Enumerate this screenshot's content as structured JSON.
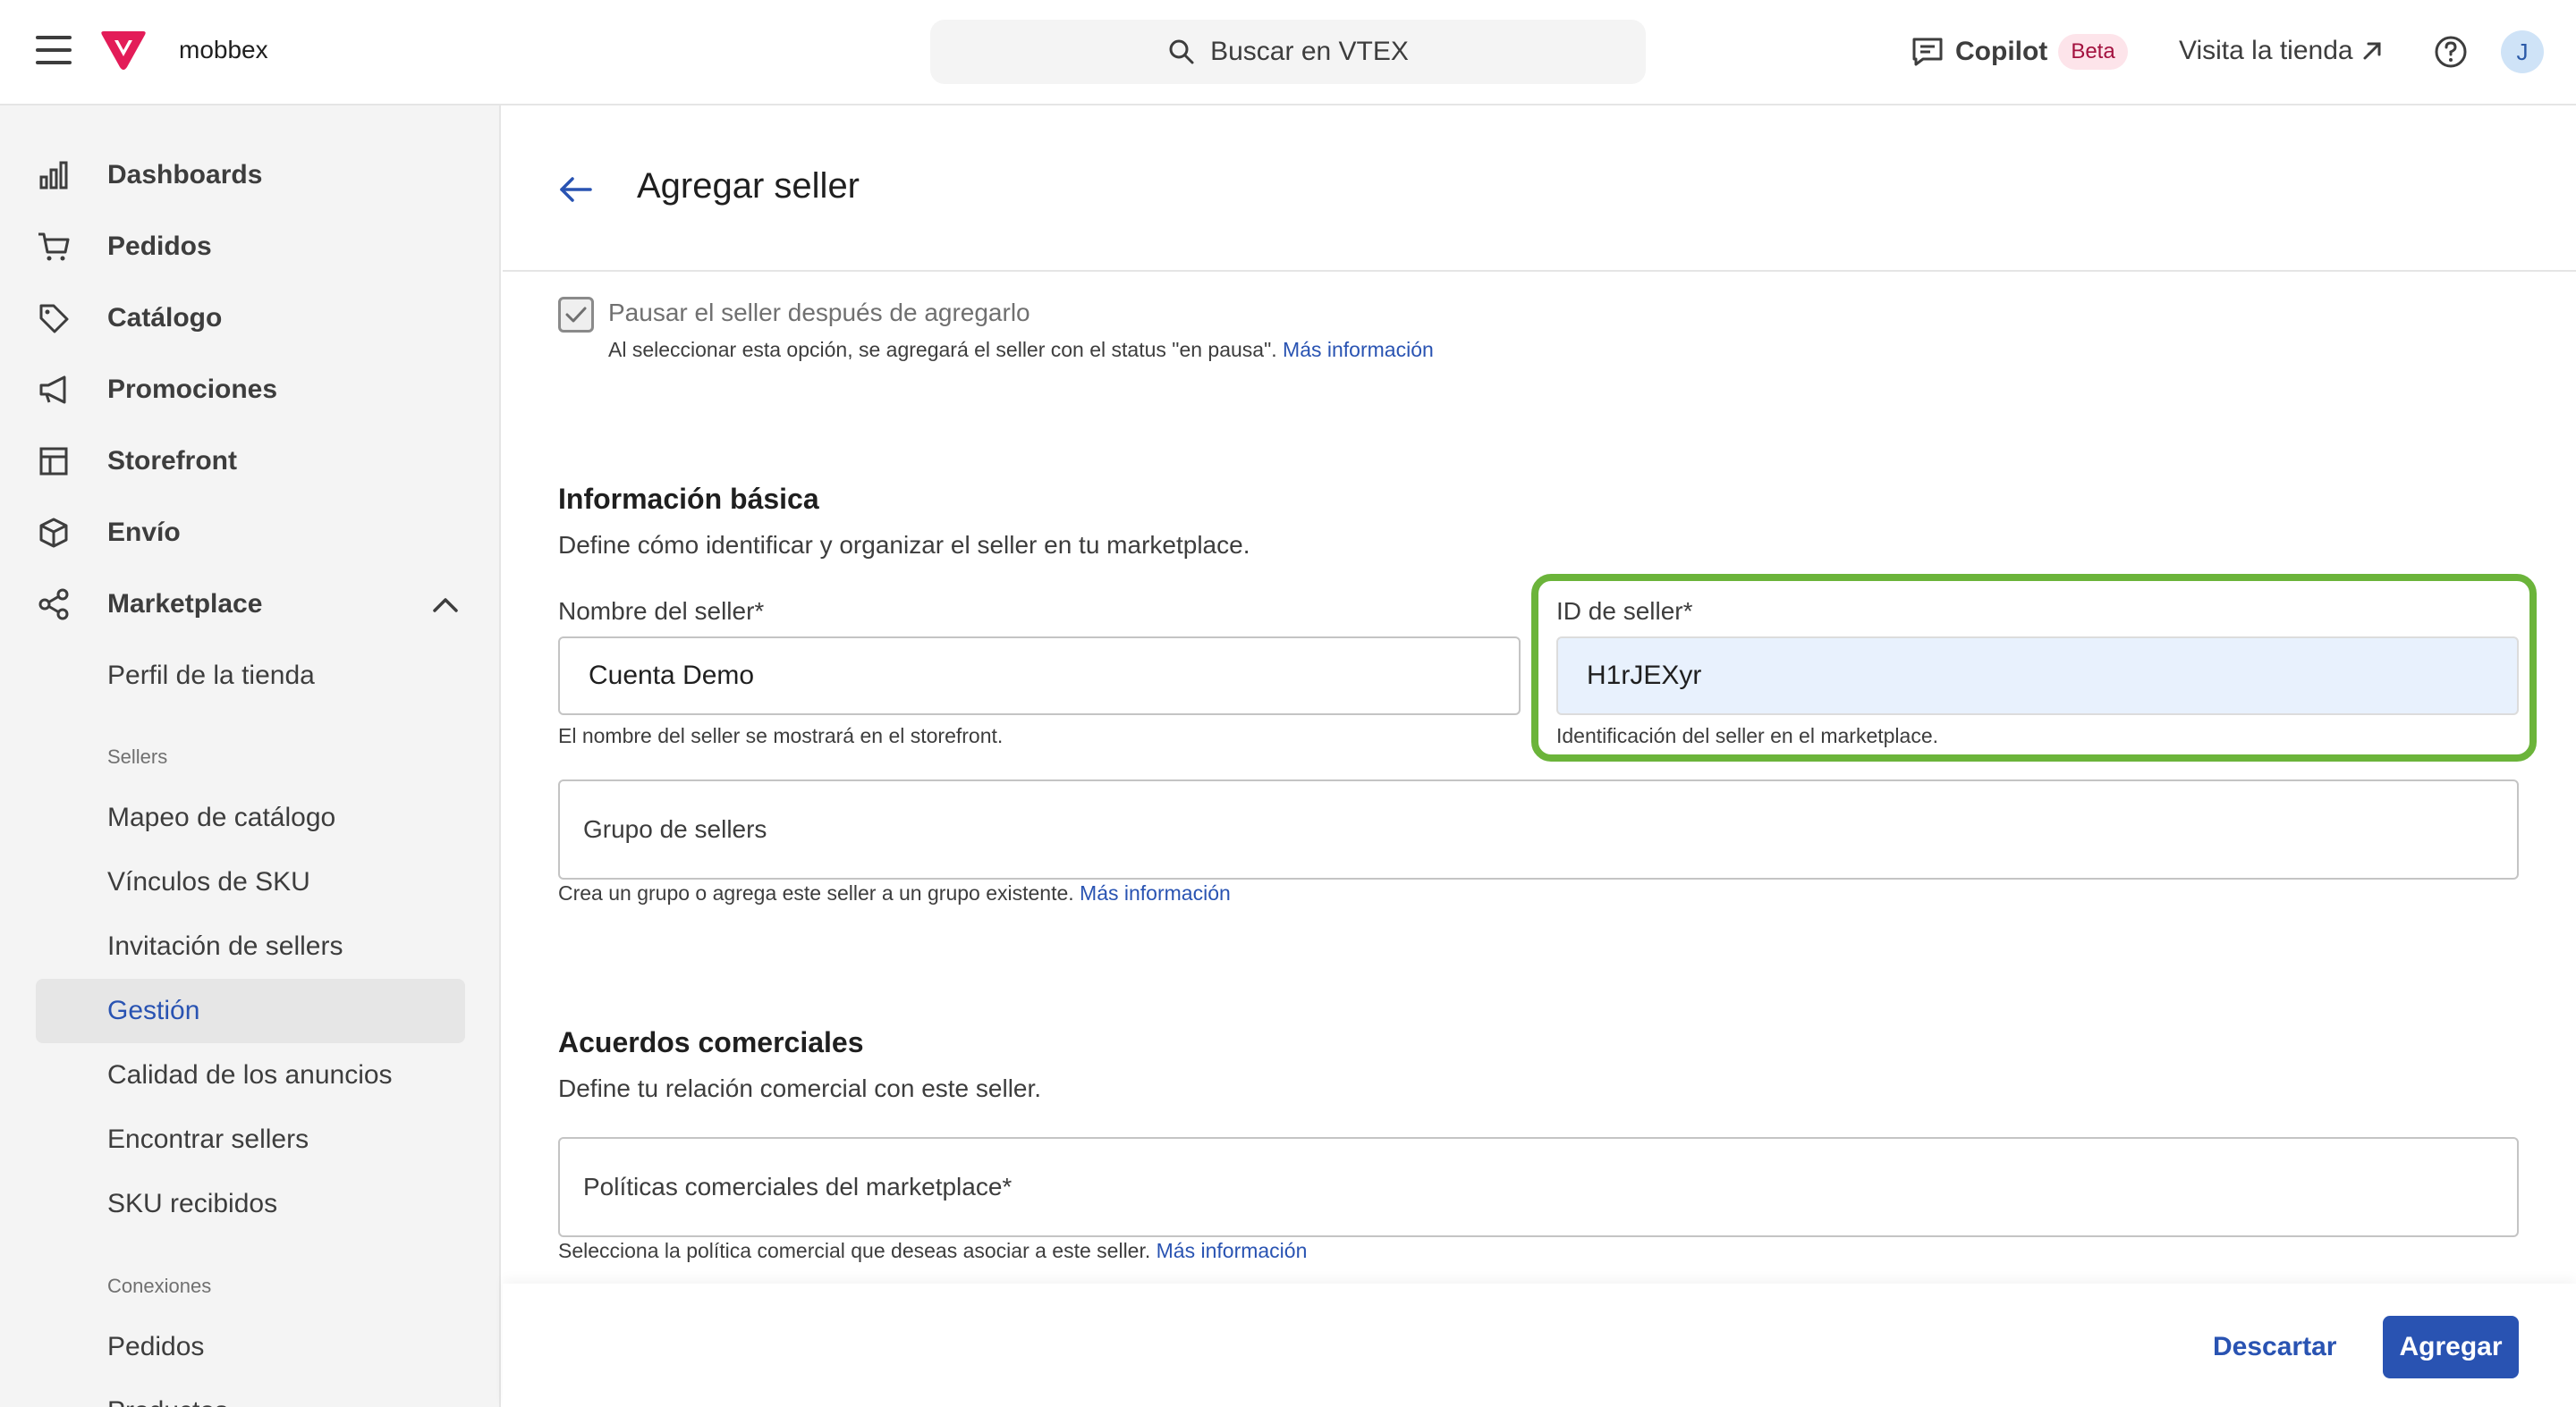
{
  "topbar": {
    "account_name": "mobbex",
    "search_placeholder": "Buscar en VTEX",
    "copilot_label": "Copilot",
    "copilot_badge": "Beta",
    "visit_store_label": "Visita la tienda",
    "avatar_initial": "J",
    "brand_color": "#e31c58"
  },
  "sidebar": {
    "items": [
      {
        "label": "Dashboards",
        "icon": "bar-chart-icon"
      },
      {
        "label": "Pedidos",
        "icon": "cart-icon"
      },
      {
        "label": "Catálogo",
        "icon": "tag-icon"
      },
      {
        "label": "Promociones",
        "icon": "megaphone-icon"
      },
      {
        "label": "Storefront",
        "icon": "layout-icon"
      },
      {
        "label": "Envío",
        "icon": "box-icon"
      },
      {
        "label": "Marketplace",
        "icon": "share-icon"
      }
    ],
    "marketplace_sub": {
      "store_profile": "Perfil de la tienda",
      "sellers_header": "Sellers",
      "sellers_items": [
        "Mapeo de catálogo",
        "Vínculos de SKU",
        "Invitación de sellers",
        "Gestión",
        "Calidad de los anuncios",
        "Encontrar sellers",
        "SKU recibidos"
      ],
      "active_item": "Gestión",
      "connections_header": "Conexiones",
      "connections_items": [
        "Pedidos",
        "Productos"
      ]
    }
  },
  "page": {
    "title": "Agregar seller",
    "pause_checkbox": {
      "label": "Pausar el seller después de agregarlo",
      "help": "Al seleccionar esta opción, se agregará el seller con el status \"en pausa\".",
      "link": "Más información",
      "checked": true
    },
    "basic_info": {
      "title": "Información básica",
      "description": "Define cómo identificar y organizar el seller en tu marketplace.",
      "seller_name_label": "Nombre del seller*",
      "seller_name_value": "Cuenta Demo",
      "seller_name_help": "El nombre del seller se mostrará en el storefront.",
      "seller_id_label": "ID de seller*",
      "seller_id_value": "H1rJEXyr",
      "seller_id_help": "Identificación del seller en el marketplace.",
      "seller_group_placeholder": "Grupo de sellers",
      "seller_group_help": "Crea un grupo o agrega este seller a un grupo existente.",
      "seller_group_link": "Más información"
    },
    "commercial": {
      "title": "Acuerdos comerciales",
      "description": "Define tu relación comercial con este seller.",
      "policies_placeholder": "Políticas comerciales del marketplace*",
      "policies_help": "Selecciona la política comercial que deseas asociar a este seller.",
      "policies_link": "Más información"
    },
    "footer": {
      "discard_label": "Descartar",
      "add_label": "Agregar"
    }
  },
  "colors": {
    "accent": "#2953b2",
    "highlight": "#6bb43a",
    "input_filled_bg": "#e8f1fd"
  }
}
